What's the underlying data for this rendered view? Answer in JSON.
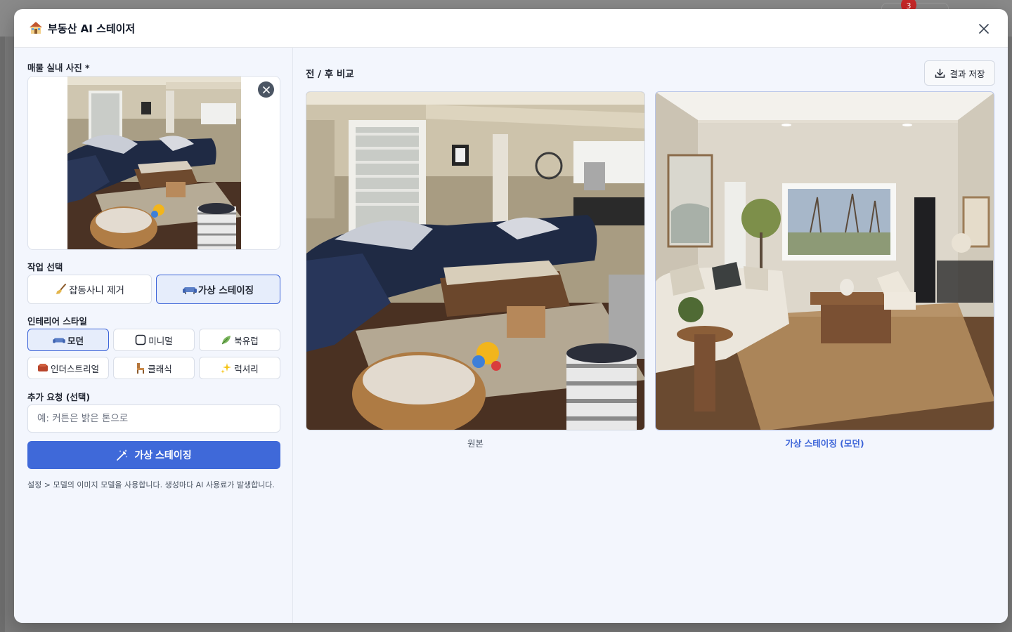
{
  "background": {
    "notification_count": "3"
  },
  "modal": {
    "title": "부동산 AI 스테이저",
    "icons": {
      "title": "house-icon",
      "close": "close-icon"
    }
  },
  "left_panel": {
    "photo_label": "매물 실내 사진 *",
    "task_label": "작업 선택",
    "tasks": [
      {
        "label": "잡동사니 제거",
        "icon": "broom-icon",
        "active": false
      },
      {
        "label": "가상 스테이징",
        "icon": "sofa-icon",
        "active": true
      }
    ],
    "style_label": "인테리어 스타일",
    "styles": [
      {
        "label": "모던",
        "icon": "sofa-icon",
        "active": true
      },
      {
        "label": "미니멀",
        "icon": "square-icon",
        "active": false
      },
      {
        "label": "북유럽",
        "icon": "leaf-icon",
        "active": false
      },
      {
        "label": "인더스트리얼",
        "icon": "brick-icon",
        "active": false
      },
      {
        "label": "클래식",
        "icon": "chair-icon",
        "active": false
      },
      {
        "label": "럭셔리",
        "icon": "sparkles-icon",
        "active": false
      }
    ],
    "request_label": "추가 요청 (선택)",
    "request_placeholder": "예: 커튼은 밝은 톤으로",
    "request_value": "",
    "stage_button_label": "가상 스테이징",
    "footnote": "설정 > 모델의 이미지 모델을 사용합니다. 생성마다 AI 사용료가 발생합니다."
  },
  "right_panel": {
    "title": "전 / 후 비교",
    "save_button_label": "결과 저장",
    "before_caption": "원본",
    "after_caption": "가상 스테이징 (모던)"
  },
  "colors": {
    "accent": "#3f69d9",
    "panel_bg": "#f3f6fd",
    "active_bg": "#e6edfb"
  }
}
